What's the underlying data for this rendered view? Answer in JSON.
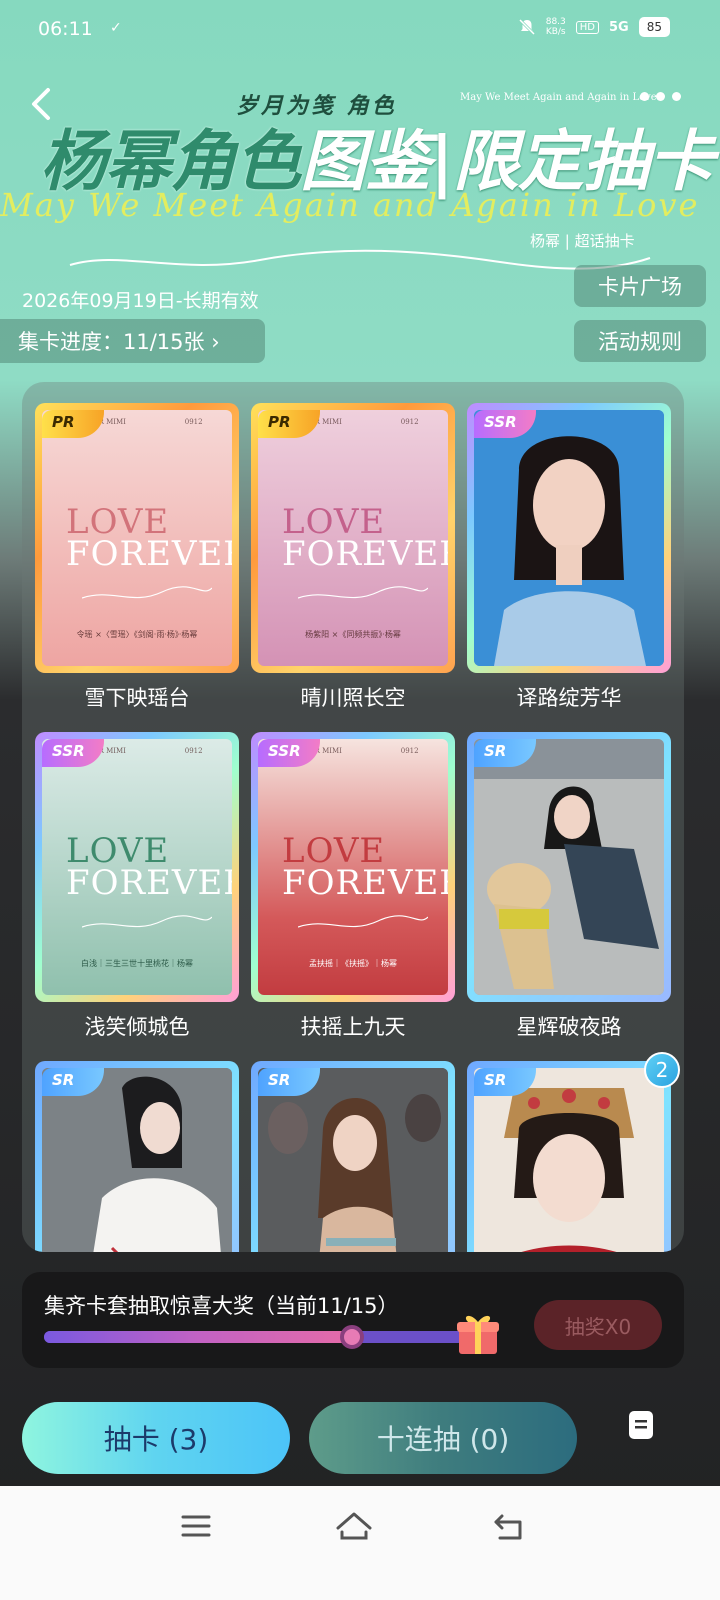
{
  "status_bar": {
    "time": "06:11",
    "check": "✓",
    "speed_value": "88.3",
    "speed_unit": "KB/s",
    "hd": "HD",
    "network": "5G",
    "battery": "85"
  },
  "header": {
    "subtitle_cn": "岁月为笺 角色",
    "subtitle_en": "May We Meet Again and Again in Love",
    "title_part1": "杨幂角色",
    "title_part2": "图鉴",
    "title_sep": "|",
    "title_part3": "限定抽卡",
    "title_script": "May We Meet Again and Again in Love",
    "title_tag": "杨幂 | 超话抽卡",
    "date": "2026年09月19日-长期有效",
    "plaza_label": "卡片广场",
    "rules_label": "活动规则",
    "progress_label": "集卡进度：11/15张 ›"
  },
  "cards": [
    {
      "rarity": "PR",
      "name": "雪下映瑶台",
      "love": "LOVE",
      "forever": "FOREVER",
      "top_left": "ALL FOR MIMI",
      "top_right": "0912",
      "caption": "令瑶 ×〈雪瑶〉《剑阁·雨·杨》·杨幂"
    },
    {
      "rarity": "PR",
      "name": "晴川照长空",
      "love": "LOVE",
      "forever": "FOREVER",
      "top_left": "ALL FOR MIMI",
      "top_right": "0912",
      "caption": "杨紫阳 ×《同频共振》·杨幂"
    },
    {
      "rarity": "SSR",
      "name": "译路绽芳华"
    },
    {
      "rarity": "SSR",
      "name": "浅笑倾城色",
      "love": "LOVE",
      "forever": "FOREVER",
      "top_left": "ALL FOR MIMI",
      "top_right": "0912",
      "caption": "白浅｜三生三世十里桃花｜杨幂"
    },
    {
      "rarity": "SSR",
      "name": "扶摇上九天",
      "love": "LOVE",
      "forever": "FOREVER",
      "top_left": "ALL FOR MIMI",
      "top_right": "0912",
      "caption": "孟扶摇｜《扶摇》｜杨幂"
    },
    {
      "rarity": "SR",
      "name": "星辉破夜路"
    },
    {
      "rarity": "SR"
    },
    {
      "rarity": "SR"
    },
    {
      "rarity": "SR",
      "count": "2"
    }
  ],
  "reward": {
    "title": "集齐卡套抽取惊喜大奖（当前11/15）",
    "progress": 0.7333,
    "draw_label": "抽奖X0"
  },
  "actions": {
    "draw_one": "抽卡 (3)",
    "draw_ten": "十连抽 (0)"
  },
  "colors": {
    "bg_top": "#86d9bf",
    "bg_bottom": "#212223",
    "draw_one_gradient": "#8ff5df",
    "draw_ten_gradient": "#3e7c7e"
  },
  "icons": [
    "back-arrow-icon",
    "more-dots-icon",
    "gift-icon",
    "notes-icon",
    "nav-menu-icon",
    "nav-home-icon",
    "nav-back-icon"
  ]
}
